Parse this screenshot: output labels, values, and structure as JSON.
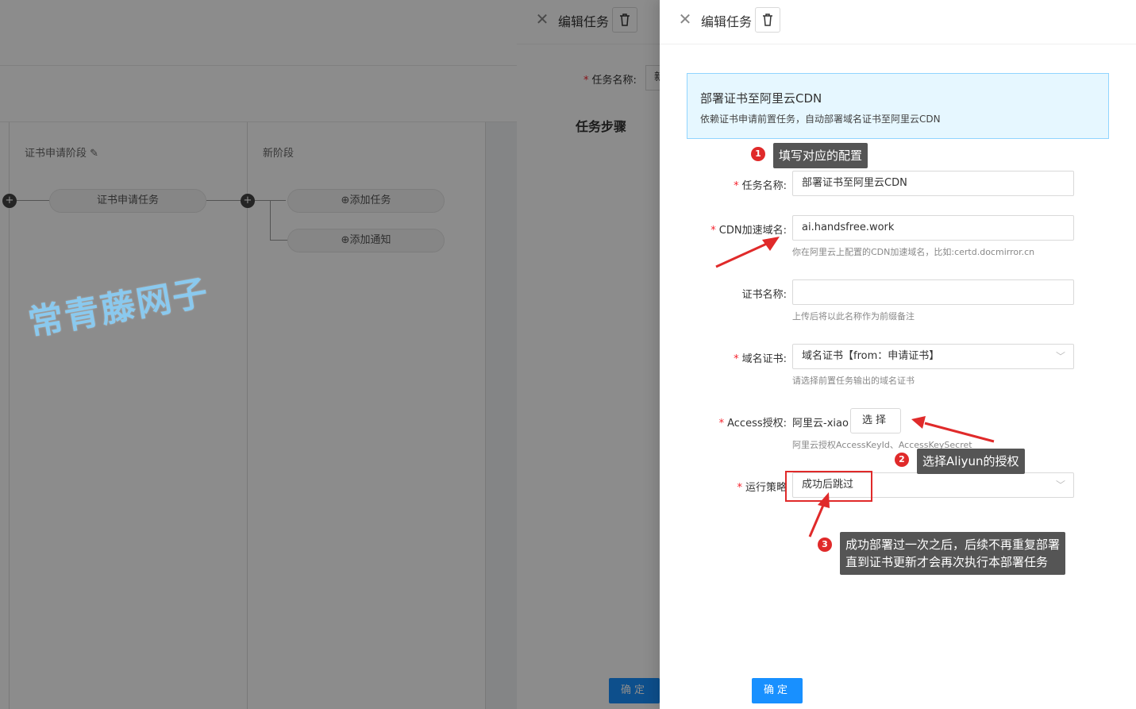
{
  "background": {
    "stage1_title": "证书申请阶段",
    "stage1_task": "证书申请任务",
    "stage2_title": "新阶段",
    "add_task": "添加任务",
    "add_notice": "添加通知",
    "watermark": "常青藤网子"
  },
  "drawer_back": {
    "title": "编辑任务",
    "task_name_label": "任务名称:",
    "task_name_value_partial": "新",
    "steps_heading": "任务步骤",
    "ok_label": "确定"
  },
  "drawer": {
    "title": "编辑任务",
    "info": {
      "title": "部署证书至阿里云CDN",
      "desc": "依赖证书申请前置任务，自动部署域名证书至阿里云CDN"
    },
    "form": {
      "task_name": {
        "label": "任务名称:",
        "value": "部署证书至阿里云CDN"
      },
      "cdn_domain": {
        "label": "CDN加速域名:",
        "value": "ai.handsfree.work",
        "hint": "你在阿里云上配置的CDN加速域名，比如:certd.docmirror.cn"
      },
      "cert_name": {
        "label": "证书名称:",
        "value": "",
        "hint": "上传后将以此名称作为前缀备注"
      },
      "domain_cert": {
        "label": "域名证书:",
        "value": "域名证书【from：申请证书】",
        "hint": "请选择前置任务输出的域名证书"
      },
      "access": {
        "label": "Access授权:",
        "value": "阿里云-xiao",
        "button": "选择",
        "hint": "阿里云授权AccessKeyId、AccessKeySecret"
      },
      "strategy": {
        "label": "运行策略",
        "value": "成功后跳过"
      }
    },
    "ok_label": "确定"
  },
  "annotations": [
    {
      "num": "1",
      "text": "填写对应的配置"
    },
    {
      "num": "2",
      "text": "选择Aliyun的授权"
    },
    {
      "num": "3",
      "line1": "成功部署过一次之后，后续不再重复部署",
      "line2": "直到证书更新才会再次执行本部署任务"
    }
  ],
  "colors": {
    "primary": "#1890ff",
    "annotation_red": "#e02a2a",
    "info_bg": "#e6f7ff"
  },
  "icons": {
    "close": "close-icon",
    "delete": "trash-icon",
    "chevron": "chevron-down-icon",
    "add": "plus-circle-icon",
    "edit": "pencil-icon"
  }
}
